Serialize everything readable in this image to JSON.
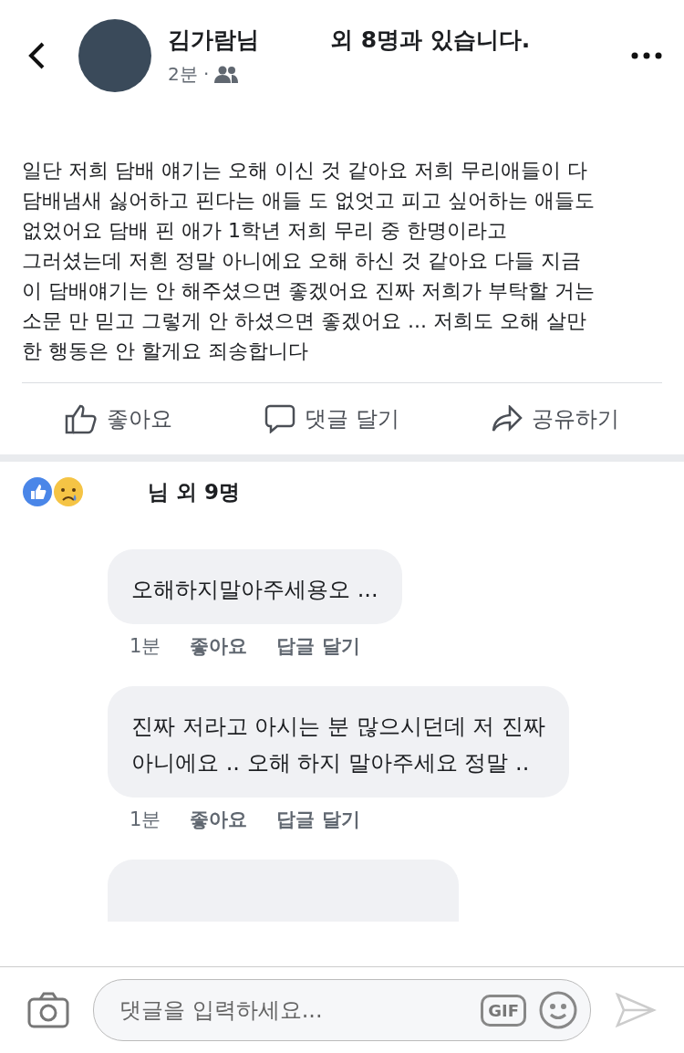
{
  "header": {
    "name": "김가람님",
    "with_text": "외 8명과 있습니다.",
    "time": "2분 ·"
  },
  "post": {
    "lines": [
      "일단 저희 담배 얘기는 오해 이신 것 같아요 저희 무리애들이 다",
      "담배냄새 싫어하고 핀다는 애들 도 없엇고 피고 싶어하는 애들도",
      "없었어요 담배 핀 애가 1학년 저희 무리 중 한명이라고",
      "그러셨는데 저흰 정말 아니에요 오해 하신 것 같아요 다들 지금",
      "이 담배얘기는 안 해주셨으면 좋겠어요 진짜 저희가 부탁할 거는",
      "소문 만 믿고 그렇게 안 하셨으면 좋겠어요 ... 저희도 오해 살만",
      "한 행동은 안 할게요 죄송합니다"
    ]
  },
  "actions": [
    {
      "kind": "like",
      "label": "좋아요"
    },
    {
      "kind": "comment",
      "label": "댓글 달기"
    },
    {
      "kind": "share",
      "label": "공유하기"
    }
  ],
  "reactions": {
    "text": "님 외 9명"
  },
  "comments": [
    {
      "lines": [
        "오해하지말아주세용오 ..."
      ],
      "time": "1분",
      "like": "좋아요",
      "reply": "답글 달기"
    },
    {
      "lines": [
        "진짜 저라고 아시는 분 많으시던데 저 진짜",
        "아니에요 .. 오해 하지 말아주세요 정말 .."
      ],
      "time": "1분",
      "like": "좋아요",
      "reply": "답글 달기"
    }
  ],
  "composer": {
    "placeholder": "댓글을 입력하세요...",
    "gif": "GIF"
  }
}
